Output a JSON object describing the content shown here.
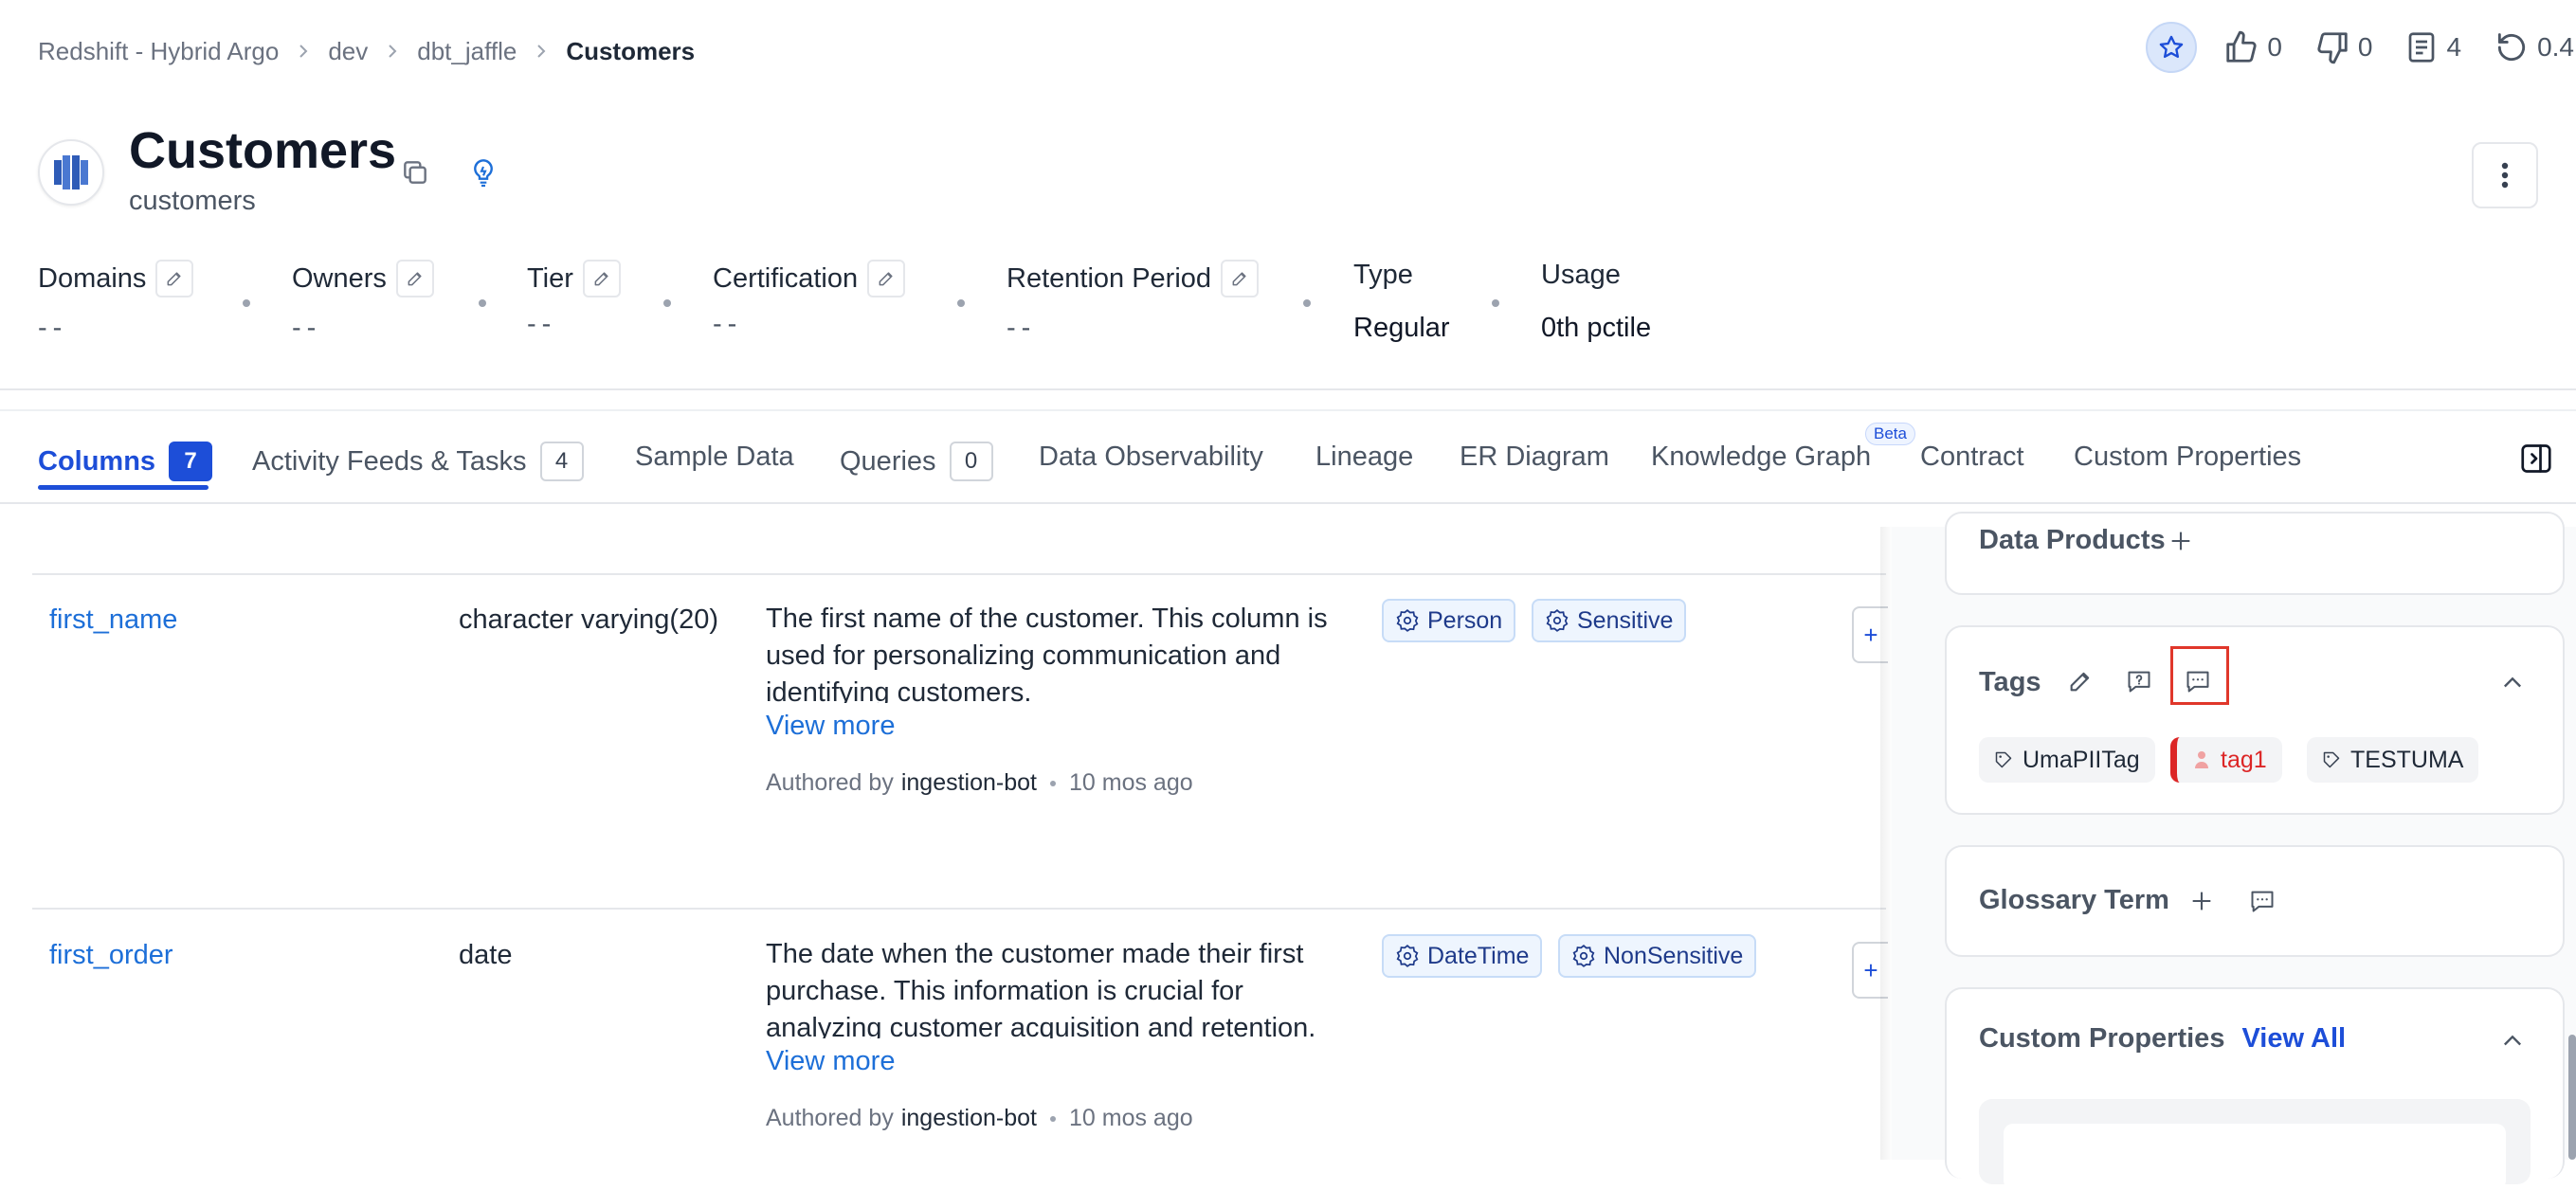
{
  "breadcrumb": {
    "items": [
      "Redshift - Hybrid Argo",
      "dev",
      "dbt_jaffle"
    ],
    "current": "Customers"
  },
  "stats": {
    "likes": "0",
    "dislikes": "0",
    "tasks": "4",
    "version": "0.4"
  },
  "header": {
    "title": "Customers",
    "subtitle": "customers"
  },
  "meta": {
    "domains_label": "Domains",
    "domains_value": "--",
    "owners_label": "Owners",
    "owners_value": "--",
    "tier_label": "Tier",
    "tier_value": "--",
    "certification_label": "Certification",
    "certification_value": "--",
    "retention_label": "Retention Period",
    "retention_value": "--",
    "type_label": "Type",
    "type_value": "Regular",
    "usage_label": "Usage",
    "usage_value": "0th pctile"
  },
  "tabs": [
    {
      "label": "Columns",
      "count": "7"
    },
    {
      "label": "Activity Feeds & Tasks",
      "count": "4"
    },
    {
      "label": "Sample Data"
    },
    {
      "label": "Queries",
      "count": "0"
    },
    {
      "label": "Data Observability"
    },
    {
      "label": "Lineage"
    },
    {
      "label": "ER Diagram"
    },
    {
      "label": "Knowledge Graph",
      "badge": "Beta"
    },
    {
      "label": "Contract"
    },
    {
      "label": "Custom Properties"
    }
  ],
  "rows": [
    {
      "name": "first_name",
      "type": "character varying(20)",
      "desc1": "The first name of the customer. This column is",
      "desc2": "used for personalizing communication and",
      "desc3": "identifying customers.",
      "view_more": "View more",
      "authored_prefix": "Authored by",
      "author": "ingestion-bot",
      "time": "10 mos ago",
      "tags": [
        "Person",
        "Sensitive"
      ]
    },
    {
      "name": "first_order",
      "type": "date",
      "desc1": "The date when the customer made their first",
      "desc2": "purchase. This information is crucial for",
      "desc3": "analyzing customer acquisition and retention.",
      "view_more": "View more",
      "authored_prefix": "Authored by",
      "author": "ingestion-bot",
      "time": "10 mos ago",
      "tags": [
        "DateTime",
        "NonSensitive"
      ]
    }
  ],
  "side": {
    "data_products": "Data Products",
    "tags_title": "Tags",
    "tags": [
      "UmaPIITag",
      "tag1",
      "TESTUMA"
    ],
    "glossary_title": "Glossary Term",
    "custom_title": "Custom Properties",
    "view_all": "View All"
  },
  "colors": {
    "accent": "#1d4ed8",
    "link": "#1d6fd8",
    "tag1": "#dc2626",
    "highlight": "#e0372b"
  }
}
